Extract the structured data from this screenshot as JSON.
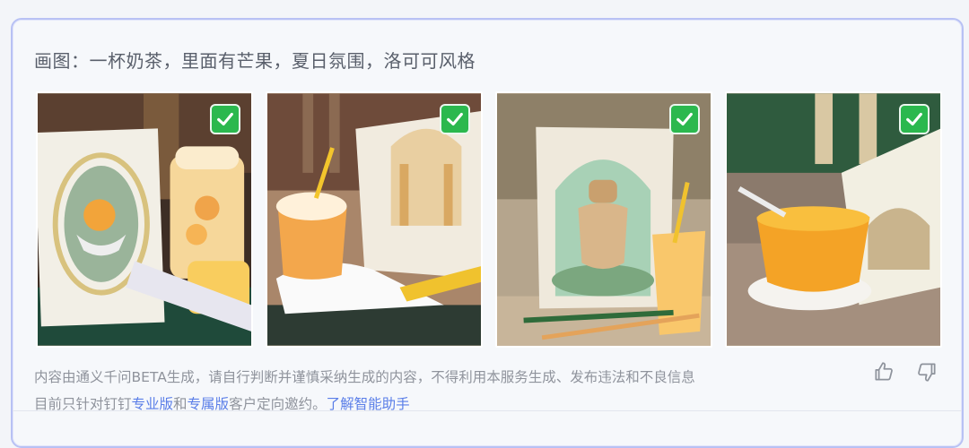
{
  "prompt": {
    "text": "画图：一杯奶茶，里面有芒果，夏日氛围，洛可可风格"
  },
  "images": [
    {
      "alt": "奶茶配芒果 洛可可风格 1",
      "selected": true,
      "icon": "check-icon"
    },
    {
      "alt": "奶茶配芒果 洛可可风格 2",
      "selected": true,
      "icon": "check-icon"
    },
    {
      "alt": "奶茶配芒果 洛可可风格 3",
      "selected": true,
      "icon": "check-icon"
    },
    {
      "alt": "奶茶配芒果 洛可可风格 4",
      "selected": true,
      "icon": "check-icon"
    }
  ],
  "disclaimer": {
    "line1": "内容由通义千问BETA生成，请自行判断并谨慎采纳生成的内容，不得利用本服务生成、发布违法和不良信息",
    "line2_prefix": "目前只针对钉钉",
    "link_pro": "专业版",
    "and": "和",
    "link_exclusive": "专属版",
    "line2_suffix": "客户定向邀约。",
    "link_learn": "了解智能助手"
  },
  "feedback": {
    "like_icon": "thumbs-up-icon",
    "dislike_icon": "thumbs-down-icon"
  },
  "colors": {
    "accent_border": "#b8c1f4",
    "check_green": "#2bb84e",
    "link": "#5a7ee8"
  }
}
